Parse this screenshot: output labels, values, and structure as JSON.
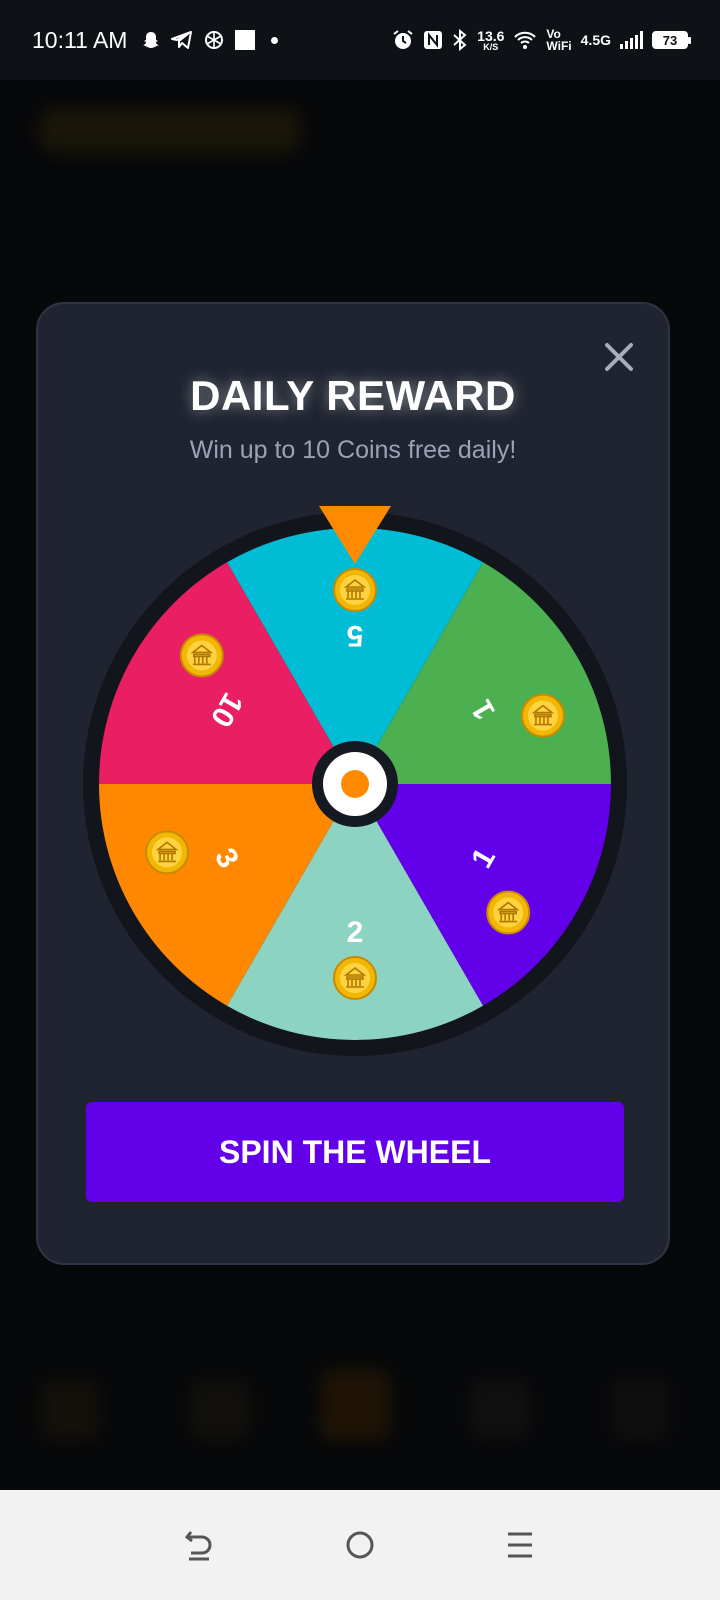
{
  "status_bar": {
    "time": "10:11 AM",
    "net_speed_value": "13.6",
    "net_speed_unit": "K/S",
    "vowifi_top": "Vo",
    "vowifi_bottom": "WiFi",
    "network": "4.5G",
    "battery": "73",
    "icons": [
      "snapchat-icon",
      "telegram-icon",
      "chatgpt-icon",
      "notification-square",
      "dot",
      "alarm-icon",
      "nfc-icon",
      "bluetooth-icon",
      "wifi-icon",
      "signal-icon",
      "battery-icon"
    ]
  },
  "modal": {
    "title": "DAILY REWARD",
    "subtitle": "Win up to 10 Coins free daily!",
    "close_icon": "close-icon",
    "spin_button": "SPIN THE WHEEL"
  },
  "wheel": {
    "segments": [
      {
        "label": "5",
        "color": "#00bcd4"
      },
      {
        "label": "1",
        "color": "#4caf50"
      },
      {
        "label": "1",
        "color": "#6200ea"
      },
      {
        "label": "2",
        "color": "#8dd3c1"
      },
      {
        "label": "3",
        "color": "#ff8800"
      },
      {
        "label": "10",
        "color": "#e91e63"
      }
    ],
    "pointer_color": "#ff8a00",
    "coin_icon": "coin-icon"
  },
  "nav_bar": {
    "back_icon": "back-icon",
    "home_icon": "home-icon",
    "menu_icon": "recents-icon"
  }
}
